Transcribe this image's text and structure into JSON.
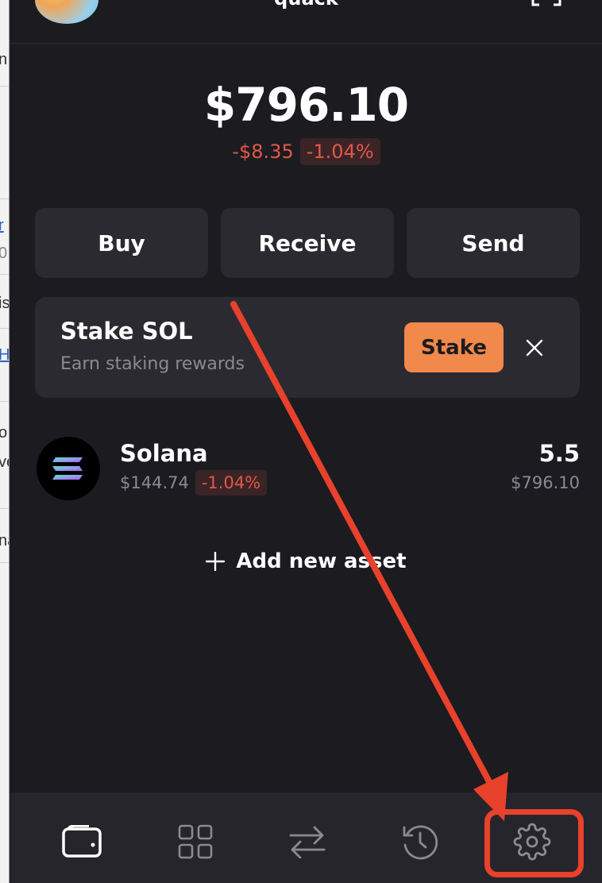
{
  "left_strip": {
    "fragments": [
      {
        "text": "n",
        "link": false
      },
      {
        "text": "r",
        "link": true
      },
      {
        "text": "0",
        "link": false
      },
      {
        "text": "is",
        "link": false
      },
      {
        "text": "H",
        "link": true
      },
      {
        "text": "o",
        "link": false
      },
      {
        "text": "ve",
        "link": false
      },
      {
        "text": "na",
        "link": false
      }
    ]
  },
  "header": {
    "account_name": "quack",
    "expand_icon": "expand-corners-icon"
  },
  "balance": {
    "total": "$796.10",
    "change_amount": "-$8.35",
    "change_percent": "-1.04%"
  },
  "actions": {
    "buy": "Buy",
    "receive": "Receive",
    "send": "Send"
  },
  "stake_card": {
    "title": "Stake SOL",
    "subtitle": "Earn staking rewards",
    "button": "Stake",
    "close_icon": "close-icon"
  },
  "assets": [
    {
      "name": "Solana",
      "price": "$144.74",
      "change": "-1.04%",
      "amount": "5.5",
      "value": "$796.10",
      "icon": "solana-logo-icon"
    }
  ],
  "add_asset": {
    "label": "Add new asset",
    "icon": "plus-icon"
  },
  "nav": {
    "items": [
      "wallet-icon",
      "apps-grid-icon",
      "swap-icon",
      "history-icon",
      "settings-gear-icon"
    ],
    "highlighted": "settings-gear-icon"
  },
  "colors": {
    "background": "#1c1b20",
    "card": "#2b2a30",
    "negative": "#e0584a",
    "accent_orange": "#f0894a",
    "annotation_red": "#e8412c"
  }
}
